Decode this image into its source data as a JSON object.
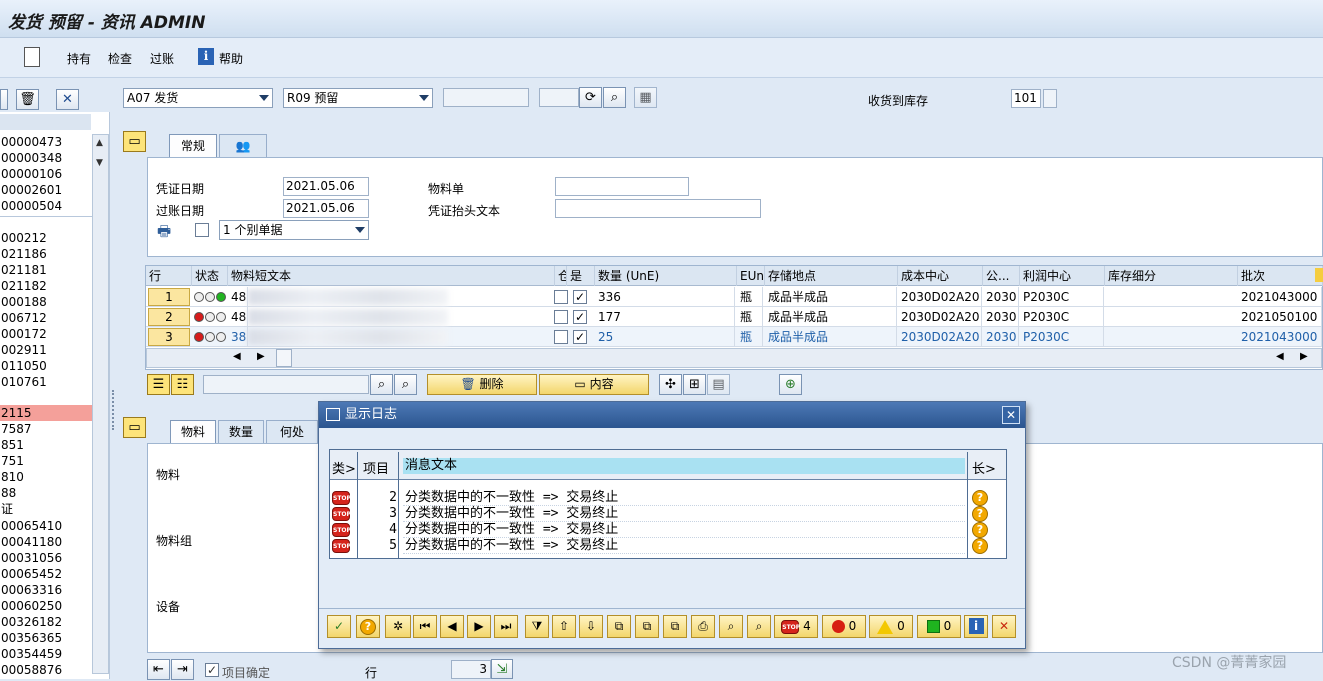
{
  "window": {
    "title": "发货 预留 - 资讯 ADMIN"
  },
  "menu": {
    "items": [
      "持有",
      "检查",
      "过账"
    ],
    "help": "帮助"
  },
  "header": {
    "movement_type": "A07 发货",
    "reference": "R09 预留",
    "receipt_label": "收货到库存",
    "movement_code": "101"
  },
  "left_list": {
    "group1": [
      "00000473",
      "00000348",
      "00000106",
      "00002601",
      "00000504"
    ],
    "group2": [
      "000212",
      "021186",
      "021181",
      "021182",
      "000188",
      "006712",
      "000172",
      "002911",
      "011050",
      "010761"
    ],
    "group3": [
      "2115",
      "7587",
      "851",
      "751",
      "810",
      "88"
    ],
    "group3_header": "证",
    "group4": [
      "00065410",
      "00041180",
      "00031056",
      "00065452",
      "00063316",
      "00060250",
      "00326182",
      "00356365",
      "00354459",
      "00058876"
    ]
  },
  "tabs_top": {
    "general": "常规",
    "partner_icon": "partner-icon"
  },
  "general": {
    "doc_date_label": "凭证日期",
    "doc_date": "2021.05.06",
    "post_date_label": "过账日期",
    "post_date": "2021.05.06",
    "material_slip_label": "物料单",
    "header_text_label": "凭证抬头文本",
    "print_option": "1 个别单据"
  },
  "items_table": {
    "headers": [
      "行",
      "状态",
      "物料短文本",
      "仓",
      "是",
      "数量 (UnE)",
      "EUn",
      "存储地点",
      "成本中心",
      "公...",
      "利润中心",
      "库存细分",
      "批次"
    ],
    "rows": [
      {
        "line": "1",
        "mat": "48",
        "qty": "336",
        "unit": "瓶",
        "sloc": "成品半成品",
        "cc": "2030D02A20",
        "co": "2030",
        "pc": "P2030C",
        "batch": "2021043000"
      },
      {
        "line": "2",
        "mat": "48",
        "qty": "177",
        "unit": "瓶",
        "sloc": "成品半成品",
        "cc": "2030D02A20",
        "co": "2030",
        "pc": "P2030C",
        "batch": "2021050100"
      },
      {
        "line": "3",
        "mat": "38",
        "qty": "25",
        "unit": "瓶",
        "sloc": "成品半成品",
        "cc": "2030D02A20",
        "co": "2030",
        "pc": "P2030C",
        "batch": "2021043000"
      }
    ]
  },
  "item_toolbar": {
    "delete": "删除",
    "content": "内容"
  },
  "tabs_detail": [
    "物料",
    "数量",
    "何处"
  ],
  "detail": {
    "material": "物料",
    "material_group": "物料组",
    "equipment": "设备"
  },
  "footer": {
    "item_ok": "项目确定",
    "line_label": "行",
    "line_value": "3"
  },
  "dialog": {
    "title": "显示日志",
    "col_type": "类>",
    "col_item": "项目",
    "col_text": "消息文本",
    "col_long": "长>",
    "messages": [
      {
        "item": "2",
        "text": "分类数据中的不一致性 => 交易终止"
      },
      {
        "item": "3",
        "text": "分类数据中的不一致性 => 交易终止"
      },
      {
        "item": "4",
        "text": "分类数据中的不一致性 => 交易终止"
      },
      {
        "item": "5",
        "text": "分类数据中的不一致性 => 交易终止"
      }
    ],
    "count_stop": "4",
    "count_error": "0",
    "count_warning": "0",
    "count_success": "0"
  },
  "watermark": "CSDN @菁菁家园"
}
